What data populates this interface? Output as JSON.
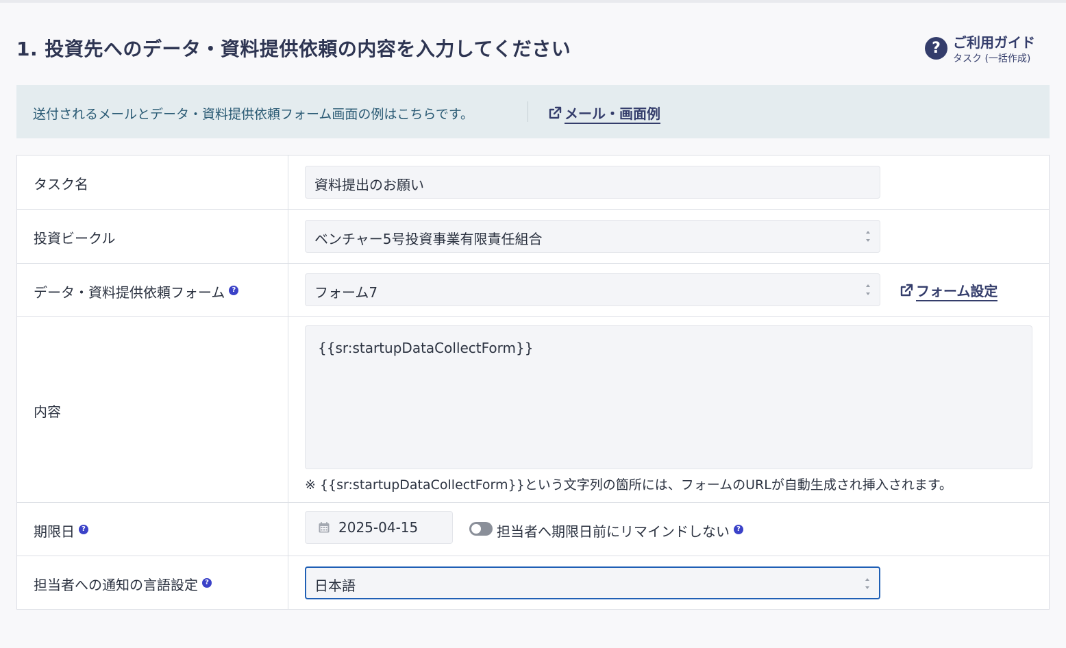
{
  "header": {
    "title": "1. 投資先へのデータ・資料提供依頼の内容を入力してください",
    "guide_icon": "question-circle-icon",
    "guide_title": "ご利用ガイド",
    "guide_subtitle": "タスク (一括作成)"
  },
  "banner": {
    "text": "送付されるメールとデータ・資料提供依頼フォーム画面の例はこちらです。",
    "link_label": "メール・画面例",
    "link_icon": "external-link-icon"
  },
  "form": {
    "task_name": {
      "label": "タスク名",
      "value": "資料提出のお願い"
    },
    "vehicle": {
      "label": "投資ビークル",
      "value": "ベンチャー5号投資事業有限責任組合"
    },
    "request_form": {
      "label": "データ・資料提供依頼フォーム",
      "help": "?",
      "value": "フォーム7",
      "settings_link": "フォーム設定"
    },
    "content": {
      "label": "内容",
      "value": "{{sr:startupDataCollectForm}}",
      "note": "※ {{sr:startupDataCollectForm}}という文字列の箇所には、フォームのURLが自動生成され挿入されます。"
    },
    "due_date": {
      "label": "期限日",
      "help": "?",
      "value": "2025-04-15",
      "calendar_icon": "calendar-icon",
      "reminder_toggle_label": "担当者へ期限日前にリマインドしない",
      "reminder_toggle_on": false
    },
    "language": {
      "label": "担当者への通知の言語設定",
      "help": "?",
      "value": "日本語"
    }
  },
  "colors": {
    "accent": "#343d6b",
    "banner_bg": "#e4ecef",
    "banner_text": "#2a5a74",
    "help_badge": "#3b42c8",
    "focus_border": "#1f5fb5"
  }
}
